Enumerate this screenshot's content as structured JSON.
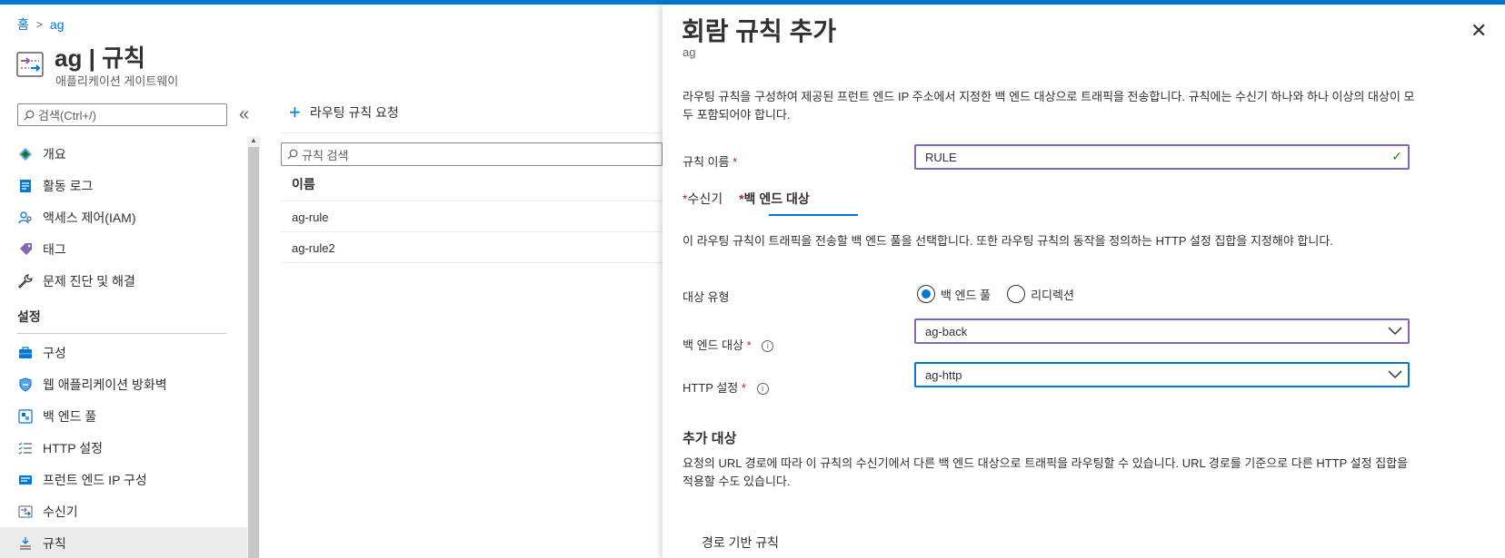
{
  "breadcrumb": {
    "home": "홈",
    "current": "ag"
  },
  "resource": {
    "title": "ag | 규칙",
    "subtitle": "애플리케이션 게이트웨이"
  },
  "sidebar": {
    "search_placeholder": "검색(Ctrl+/)",
    "collapse_glyph": "«",
    "items": [
      {
        "label": "개요",
        "icon": "overview-icon"
      },
      {
        "label": "활동 로그",
        "icon": "activity-log-icon"
      },
      {
        "label": "액세스 제어(IAM)",
        "icon": "iam-icon"
      },
      {
        "label": "태그",
        "icon": "tag-icon"
      },
      {
        "label": "문제 진단 및 해결",
        "icon": "wrench-icon"
      }
    ],
    "settings_header": "설정",
    "settings_items": [
      {
        "label": "구성",
        "icon": "configuration-icon"
      },
      {
        "label": "웹 애플리케이션 방화벽",
        "icon": "shield-icon"
      },
      {
        "label": "백 엔드 풀",
        "icon": "backend-pool-icon"
      },
      {
        "label": "HTTP 설정",
        "icon": "list-settings-icon"
      },
      {
        "label": "프런트 엔드 IP 구성",
        "icon": "frontend-ip-icon"
      },
      {
        "label": "수신기",
        "icon": "listener-icon"
      },
      {
        "label": "규칙",
        "icon": "rules-icon"
      }
    ]
  },
  "main": {
    "add_command": "라우팅 규칙 요청",
    "rule_search_placeholder": "규칙 검색",
    "column_name": "이름",
    "rows": [
      "ag-rule",
      "ag-rule2"
    ]
  },
  "panel": {
    "title": "회람 규칙 추가",
    "subtitle": "ag",
    "close_glyph": "✕",
    "description": "라우팅 규칙을 구성하여 제공된 프런트 엔드 IP 주소에서 지정한 백 엔드 대상으로 트래픽을 전송합니다. 규칙에는 수신기 하나와 하나 이상의 대상이 모두 포함되어야 합니다.",
    "rule_name_label": "규칙 이름",
    "rule_name_value": "RULE",
    "required_mark": "*",
    "tabs": {
      "listener": "수신기",
      "backend": "백 엔드 대상"
    },
    "tab_description": "이 라우팅 규칙이 트래픽을 전송할 백 엔드 풀을 선택합니다. 또한 라우팅 규칙의 동작을 정의하는 HTTP 설정 집합을 지정해야 합니다.",
    "target_type_label": "대상 유형",
    "target_options": [
      "백 엔드 풀",
      "리디렉션"
    ],
    "target_selected": "백 엔드 풀",
    "backend_target_label": "백 엔드 대상",
    "backend_target_value": "ag-back",
    "http_settings_label": "HTTP 설정",
    "http_settings_value": "ag-http",
    "additional_header": "추가 대상",
    "additional_description": "요청의 URL 경로에 따라 이 규칙의 수신기에서 다른 백 엔드 대상으로 트래픽을 라우팅할 수 있습니다. URL 경로를 기준으로 다른 HTTP 설정 집합을 적용할 수도 있습니다.",
    "path_rules_label": "경로 기반 규칙"
  },
  "colors": {
    "accent": "#0078d4",
    "valid_border": "#8764b8",
    "required": "#a4262c",
    "check": "#107c10"
  }
}
